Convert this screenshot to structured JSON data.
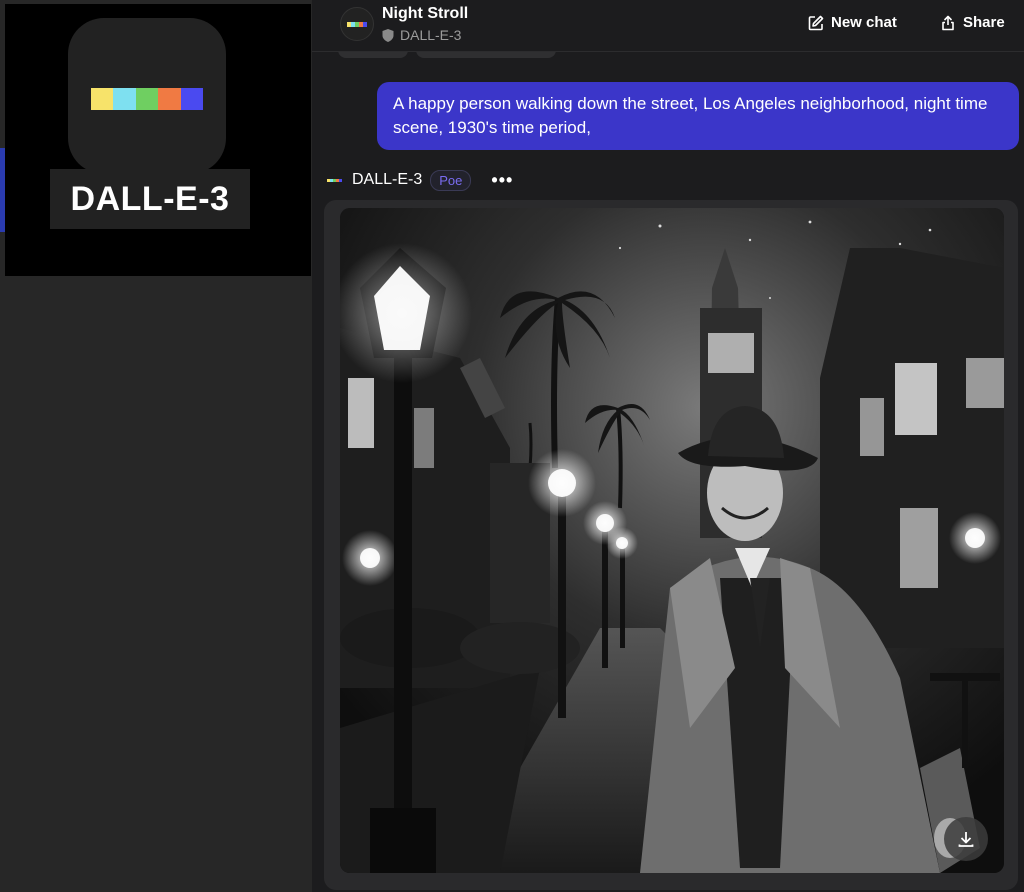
{
  "preview": {
    "label": "DALL-E-3",
    "bar_colors": [
      "#f7e36a",
      "#7ee0f0",
      "#6fcf61",
      "#f07a43",
      "#4a4af0"
    ]
  },
  "header": {
    "title": "Night Stroll",
    "bot_name": "DALL-E-3",
    "new_chat": "New chat",
    "share": "Share"
  },
  "user_message": {
    "text": "A happy person walking down the street, Los Angeles neighborhood, night time scene, 1930's time period,"
  },
  "bot_message": {
    "name": "DALL-E-3",
    "badge": "Poe",
    "more": "•••"
  },
  "colors": {
    "accent": "#3b36c9",
    "badge": "#7a6cf0"
  }
}
